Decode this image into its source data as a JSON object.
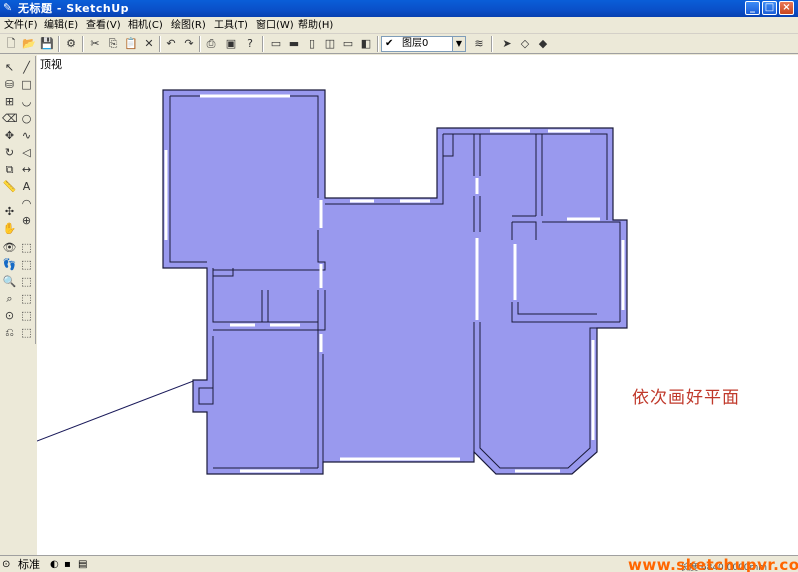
{
  "window": {
    "title": "无标题 - SketchUp"
  },
  "menu": [
    "文件(F)",
    "编辑(E)",
    "查看(V)",
    "相机(C)",
    "绘图(R)",
    "工具(T)",
    "窗口(W)",
    "帮助(H)"
  ],
  "toolbar": {
    "layer_value": "图层0"
  },
  "viewport": {
    "view_name": "顶视"
  },
  "annotation": "依次画好平面",
  "status": {
    "standard_label": "标准",
    "length": "长度 6840.0000mm"
  },
  "watermark": "www.sketchupvr.com",
  "colors": {
    "floor_fill": "#9999ee",
    "wall_stroke": "#1a1a3a",
    "annotation": "#c0392b",
    "watermark": "#ff6600"
  }
}
